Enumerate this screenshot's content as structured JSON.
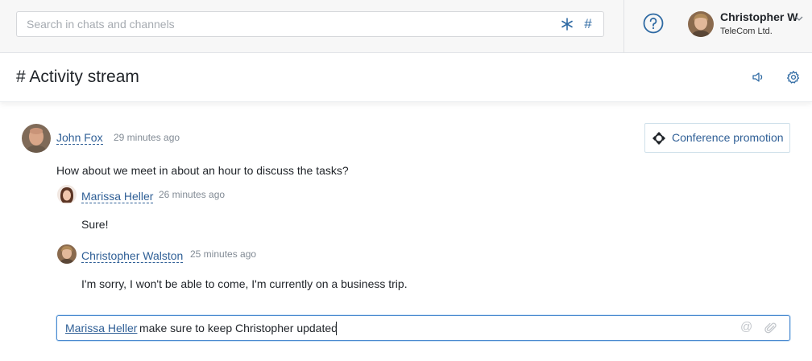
{
  "search": {
    "placeholder": "Search in chats and channels",
    "hash_symbol": "#"
  },
  "user": {
    "name": "Christopher W",
    "company": "TeleCom Ltd."
  },
  "channel": {
    "title": "# Activity stream"
  },
  "header_action": {
    "label": "Conference promotion"
  },
  "thread": {
    "author": "John Fox",
    "time": "29 minutes ago",
    "text": "How about we meet in about an hour to discuss the tasks?",
    "replies": [
      {
        "author": "Marissa Heller",
        "time": "26 minutes ago",
        "text": "Sure!"
      },
      {
        "author": "Christopher Walston",
        "time": "25 minutes ago",
        "text": "I'm sorry, I won't be able to come, I'm currently on a business trip."
      }
    ]
  },
  "reply_input": {
    "mention": "Marissa Heller",
    "text": "make sure to keep Christopher updated"
  },
  "icons": [
    "asterisk-icon",
    "hash-icon",
    "help-icon",
    "chevron-down-icon",
    "speaker-icon",
    "gear-icon",
    "conference-icon",
    "at-icon",
    "paperclip-icon"
  ],
  "colors": {
    "link": "#2f5f96",
    "accent_icon": "#2f6aa3",
    "input_focus": "#4a8ad0"
  }
}
